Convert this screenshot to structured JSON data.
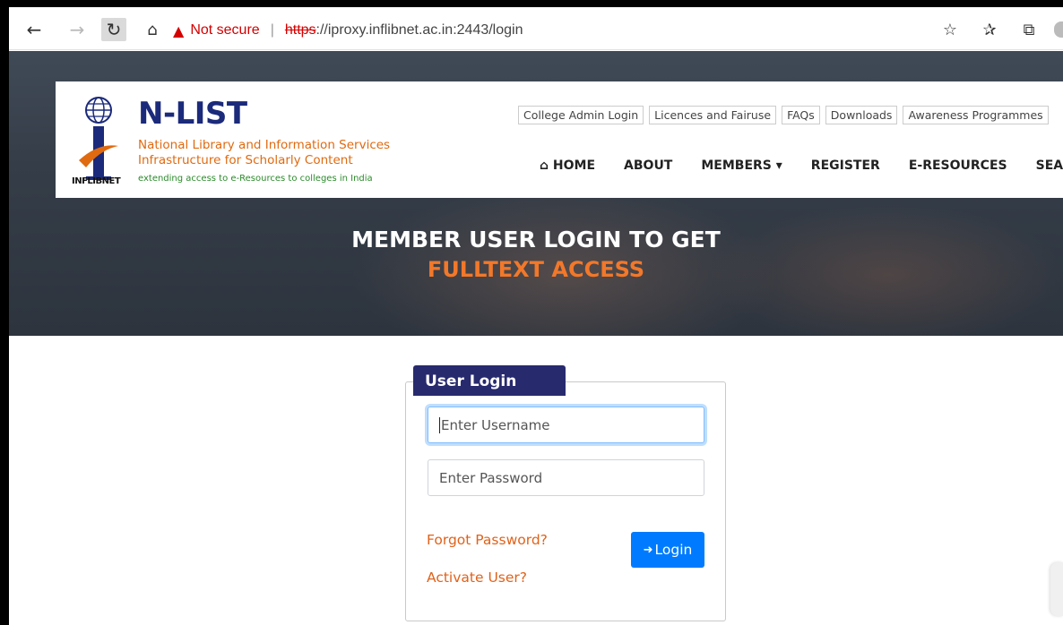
{
  "browser": {
    "back_icon": "←",
    "forward_icon": "→",
    "refresh_icon": "↻",
    "home_icon": "⌂",
    "warning_icon": "▲",
    "security_label": "Not secure",
    "separator": "|",
    "url_protocol": "https",
    "url_rest": "://iproxy.inflibnet.ac.in:2443/login",
    "favorite_icon": "☆",
    "favorites_list_icon": "✰",
    "collections_icon": "⧉"
  },
  "site": {
    "logo_title": "N-LIST",
    "logo_sub1": "National Library and Information Services",
    "logo_sub2": "Infrastructure for Scholarly Content",
    "logo_tagline": "extending access to e-Resources to colleges in India",
    "logo_org": "INFLIBNET",
    "top_links": [
      "College Admin Login",
      "Licences and Fairuse",
      "FAQs",
      "Downloads",
      "Awareness Programmes"
    ],
    "nav": {
      "home": "HOME",
      "home_icon": "⌂",
      "about": "ABOUT",
      "members": "MEMBERS",
      "members_caret": "▾",
      "register": "REGISTER",
      "eresources": "E-RESOURCES",
      "search": "SEARCH"
    },
    "hero_line1": "MEMBER USER LOGIN TO GET",
    "hero_line2": "FULLTEXT ACCESS"
  },
  "login": {
    "tab_title": "User Login",
    "username_placeholder": "Enter Username",
    "password_placeholder": "Enter Password",
    "forgot_link": "Forgot Password?",
    "activate_link": "Activate User?",
    "login_button": "Login",
    "login_icon": "➜"
  },
  "colors": {
    "brand_navy": "#282a6e",
    "accent_orange": "#f2782a",
    "link_orange": "#e0621a",
    "button_blue": "#007bff",
    "warning_red": "#d40000"
  }
}
